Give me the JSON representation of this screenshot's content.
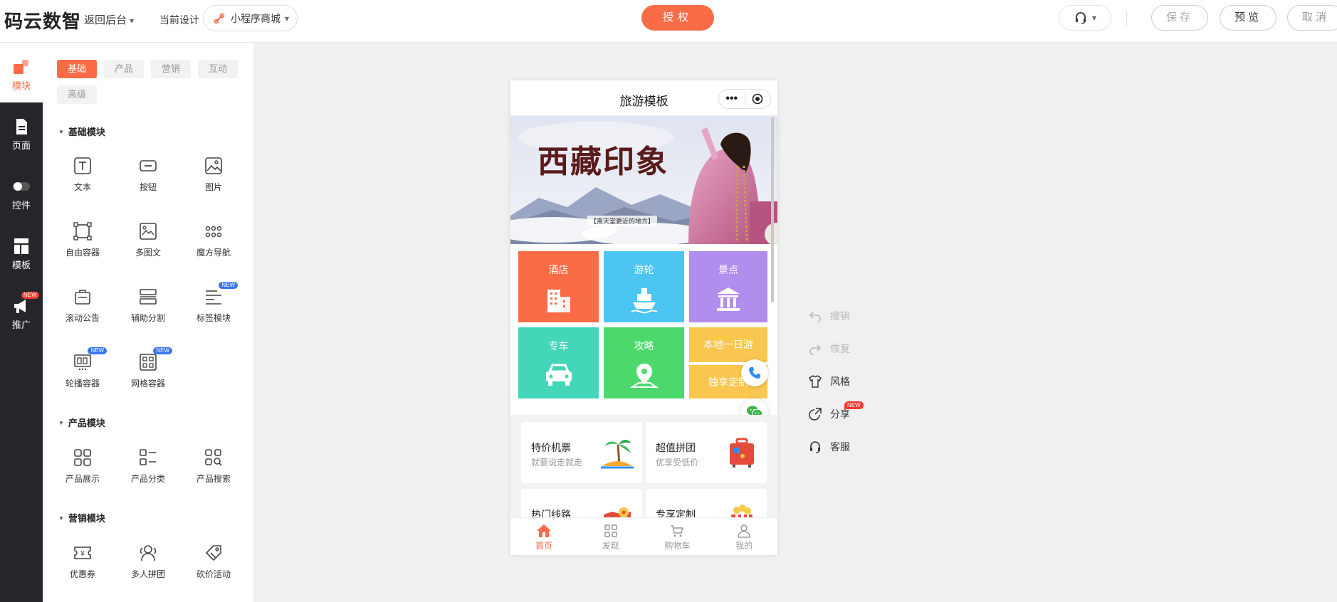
{
  "header": {
    "logo": "码云数智",
    "back_label": "返回后台",
    "current_design_label": "当前设计",
    "program_select": "小程序商城",
    "auth_button": "授权",
    "save_button": "保存",
    "preview_button": "预览",
    "cancel_button": "取消"
  },
  "rail": {
    "items": [
      {
        "label": "模块",
        "icon": "blocks-icon"
      },
      {
        "label": "页面",
        "icon": "page-icon"
      },
      {
        "label": "控件",
        "icon": "toggle-icon"
      },
      {
        "label": "模板",
        "icon": "template-icon"
      },
      {
        "label": "推广",
        "icon": "megaphone-icon",
        "badge": "NEW"
      }
    ]
  },
  "panel": {
    "tabs": [
      "基础",
      "产品",
      "营销",
      "互动",
      "高级"
    ],
    "sections": {
      "basic": {
        "title": "基础模块",
        "items": [
          {
            "label": "文本",
            "icon": "text-icon"
          },
          {
            "label": "按钮",
            "icon": "button-icon"
          },
          {
            "label": "图片",
            "icon": "image-icon"
          },
          {
            "label": "自由容器",
            "icon": "container-icon"
          },
          {
            "label": "多图文",
            "icon": "multi-image-icon"
          },
          {
            "label": "魔方导航",
            "icon": "grid-dots-icon"
          },
          {
            "label": "滚动公告",
            "icon": "notice-icon"
          },
          {
            "label": "辅助分割",
            "icon": "divider-icon"
          },
          {
            "label": "标签模块",
            "icon": "tags-icon",
            "badge": "NEW"
          },
          {
            "label": "轮播容器",
            "icon": "carousel-icon",
            "badge": "NEW"
          },
          {
            "label": "网格容器",
            "icon": "grid-container-icon",
            "badge": "NEW"
          }
        ]
      },
      "product": {
        "title": "产品模块",
        "items": [
          {
            "label": "产品展示",
            "icon": "product-grid-icon"
          },
          {
            "label": "产品分类",
            "icon": "category-list-icon"
          },
          {
            "label": "产品搜索",
            "icon": "product-search-icon"
          }
        ]
      },
      "marketing": {
        "title": "营销模块",
        "items": [
          {
            "label": "优惠券",
            "icon": "coupon-icon"
          },
          {
            "label": "多人拼团",
            "icon": "group-buy-icon"
          },
          {
            "label": "砍价活动",
            "icon": "bargain-icon"
          }
        ]
      }
    }
  },
  "phone": {
    "title": "旅游模板",
    "banner": {
      "headline": "西藏印象",
      "tagline": "【离天堂更近的地方】"
    },
    "tiles": [
      {
        "label": "酒店",
        "color": "#f96c45",
        "icon": "hotel-icon"
      },
      {
        "label": "游轮",
        "color": "#4cc5f2",
        "icon": "ship-icon"
      },
      {
        "label": "景点",
        "color": "#b18ded",
        "icon": "landmark-icon"
      },
      {
        "label": "专车",
        "color": "#44d6b8",
        "icon": "car-icon"
      },
      {
        "label": "攻略",
        "color": "#4dd86c",
        "icon": "map-pin-icon"
      },
      {
        "label": "本地一日游",
        "color": "#f9c74f"
      },
      {
        "label": "独享定制",
        "color": "#f9c74f"
      }
    ],
    "cards": [
      {
        "title": "特价机票",
        "subtitle": "就要说走就走",
        "icon": "palm-tree-icon"
      },
      {
        "title": "超值拼团",
        "subtitle": "优享受低价",
        "icon": "suitcase-icon"
      },
      {
        "title": "热门线路",
        "subtitle": "",
        "icon": "map-icon"
      },
      {
        "title": "专享定制",
        "subtitle": "",
        "icon": "gift-icon"
      }
    ],
    "tabbar": [
      {
        "label": "首页",
        "icon": "home-icon"
      },
      {
        "label": "发现",
        "icon": "discover-icon"
      },
      {
        "label": "购物车",
        "icon": "cart-icon"
      },
      {
        "label": "我的",
        "icon": "user-icon"
      }
    ]
  },
  "tools": {
    "undo": "撤销",
    "redo": "恢复",
    "style": "风格",
    "share": "分享",
    "share_badge": "NEW",
    "service": "客服"
  },
  "colors": {
    "accent": "#f96c45",
    "rail_bg": "#24262b",
    "new_blue": "#3a74f6",
    "new_red": "#f5392f"
  }
}
